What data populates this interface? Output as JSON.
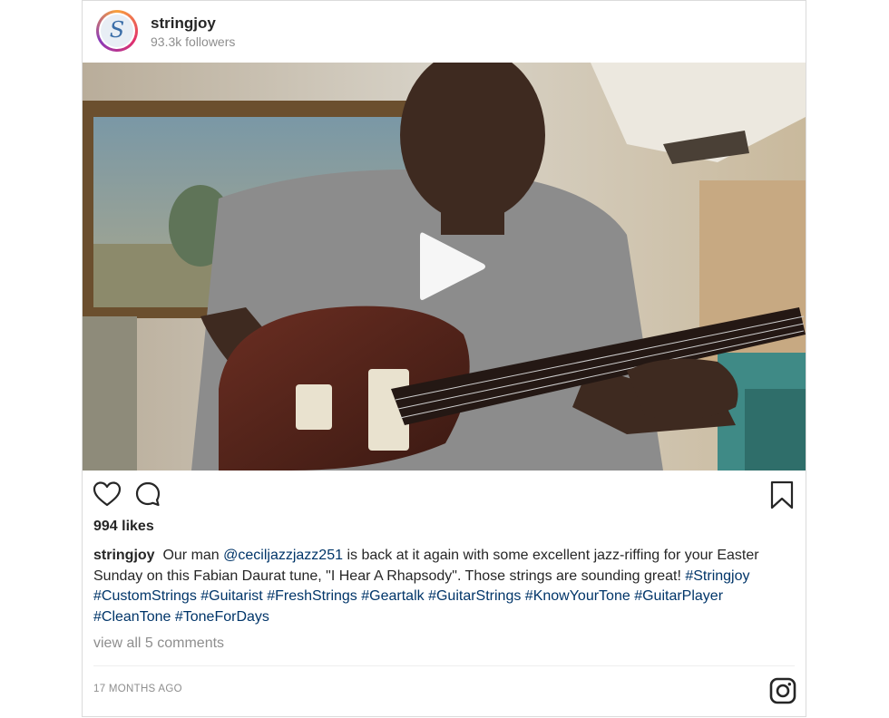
{
  "account": {
    "username": "stringjoy",
    "followers": "93.3k followers",
    "avatar_letter": "S"
  },
  "media": {
    "type": "video",
    "play_icon": "play-icon"
  },
  "actions": {
    "like_icon": "heart-icon",
    "comment_icon": "comment-bubble-icon",
    "save_icon": "bookmark-icon"
  },
  "likes": "994 likes",
  "caption": {
    "username": "stringjoy",
    "text_1": "Our man ",
    "mention": "@ceciljazzjazz251",
    "text_2": " is back at it again with some excellent jazz-riffing for your Easter Sunday on this Fabian Daurat tune, \"I Hear A Rhapsody\". Those strings are sounding great!",
    "hashtags": [
      "#Stringjoy",
      "#CustomStrings",
      "#Guitarist",
      "#FreshStrings",
      "#Geartalk",
      "#GuitarStrings",
      "#KnowYourTone",
      "#GuitarPlayer",
      "#CleanTone",
      "#ToneForDays"
    ]
  },
  "comments_link": "view all 5 comments",
  "timestamp": "17 MONTHS AGO",
  "footer_icon": "instagram-logo-icon",
  "colors": {
    "link": "#003569",
    "muted": "#8e8e8e",
    "text": "#262626",
    "border": "#dbdbdb"
  }
}
